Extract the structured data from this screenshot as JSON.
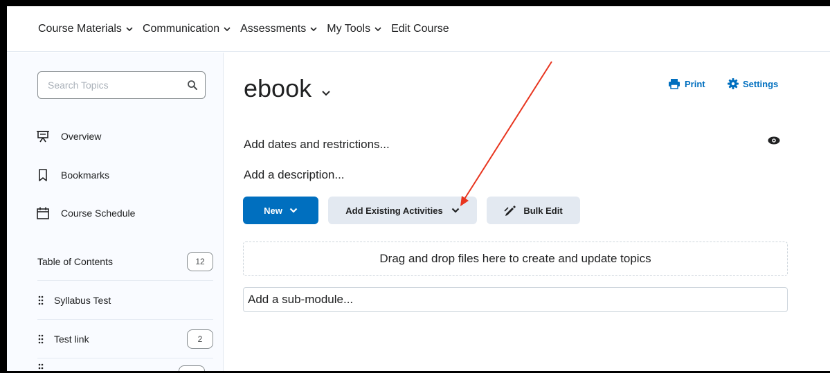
{
  "nav": {
    "items": [
      {
        "label": "Course Materials",
        "has_menu": true
      },
      {
        "label": "Communication",
        "has_menu": true
      },
      {
        "label": "Assessments",
        "has_menu": true
      },
      {
        "label": "My Tools",
        "has_menu": true
      },
      {
        "label": "Edit Course",
        "has_menu": false
      }
    ]
  },
  "sidebar": {
    "search_placeholder": "Search Topics",
    "links": [
      {
        "label": "Overview",
        "icon": "presentation-icon"
      },
      {
        "label": "Bookmarks",
        "icon": "bookmark-icon"
      },
      {
        "label": "Course Schedule",
        "icon": "calendar-icon"
      }
    ],
    "toc": {
      "label": "Table of Contents",
      "count": "12"
    },
    "modules": [
      {
        "label": "Syllabus Test",
        "count": ""
      },
      {
        "label": "Test link",
        "count": "2"
      }
    ]
  },
  "main": {
    "title": "ebook",
    "print_label": "Print",
    "settings_label": "Settings",
    "add_dates": "Add dates and restrictions...",
    "add_description": "Add a description...",
    "new_label": "New",
    "add_existing_label": "Add Existing Activities",
    "bulk_edit_label": "Bulk Edit",
    "dropzone_text": "Drag and drop files here to create and update topics",
    "submodule_placeholder": "Add a sub-module..."
  },
  "colors": {
    "accent": "#006fbf",
    "annotation_arrow": "#e8351f",
    "secondary_button": "#e3e9f1"
  }
}
